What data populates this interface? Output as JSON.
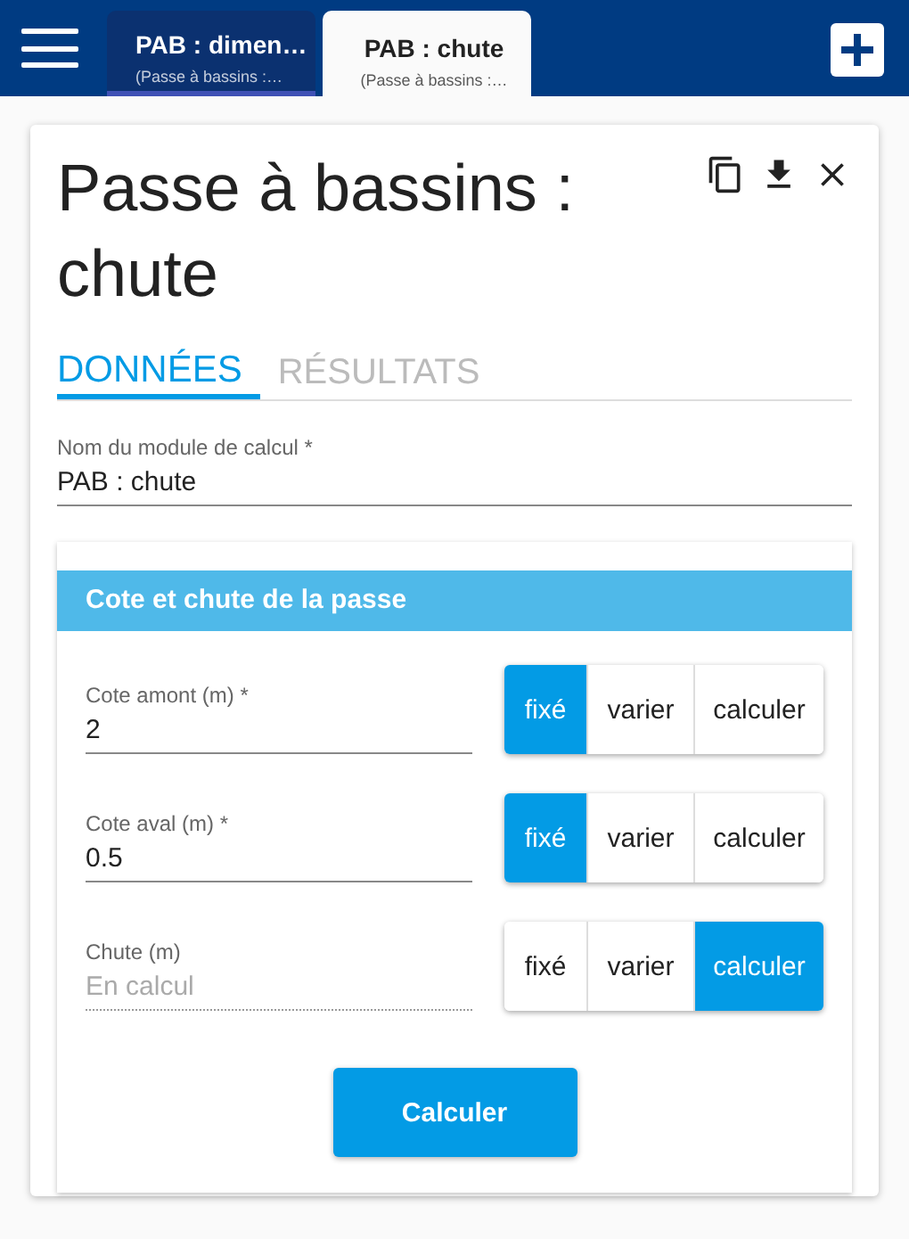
{
  "app_bar": {
    "tabs": [
      {
        "title": "PAB : dimen…",
        "subtitle": "(Passe à bassins :…",
        "selected": false
      },
      {
        "title": "PAB : chute",
        "subtitle": "(Passe à bassins :…",
        "selected": true
      }
    ]
  },
  "card": {
    "title": "Passe à bassins : chute",
    "tabs": [
      {
        "label": "DONNÉES",
        "selected": true
      },
      {
        "label": "RÉSULTATS",
        "selected": false
      }
    ],
    "name_field": {
      "label": "Nom du module de calcul *",
      "value": "PAB : chute"
    },
    "section": {
      "title": "Cote et chute de la passe",
      "params": [
        {
          "label": "Cote amont (m) *",
          "value": "2",
          "disabled": false,
          "modes": [
            {
              "label": "fixé",
              "selected": true
            },
            {
              "label": "varier",
              "selected": false
            },
            {
              "label": "calculer",
              "selected": false
            }
          ]
        },
        {
          "label": "Cote aval (m) *",
          "value": "0.5",
          "disabled": false,
          "modes": [
            {
              "label": "fixé",
              "selected": true
            },
            {
              "label": "varier",
              "selected": false
            },
            {
              "label": "calculer",
              "selected": false
            }
          ]
        },
        {
          "label": "Chute (m)",
          "placeholder": "En calcul",
          "disabled": true,
          "modes": [
            {
              "label": "fixé",
              "selected": false
            },
            {
              "label": "varier",
              "selected": false
            },
            {
              "label": "calculer",
              "selected": true
            }
          ]
        }
      ],
      "button": "Calculer"
    }
  }
}
